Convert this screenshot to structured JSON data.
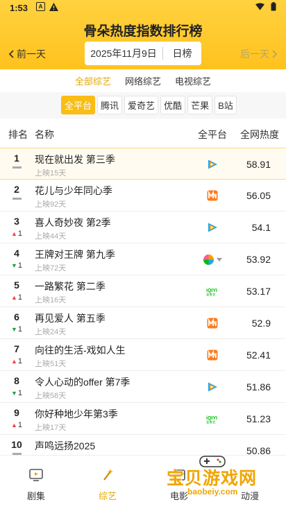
{
  "status": {
    "time": "1:53"
  },
  "header": {
    "title": "骨朵热度指数排行榜",
    "prev_label": "前一天",
    "next_label": "后一天",
    "date": "2025年11月9日",
    "period": "日榜"
  },
  "categories": [
    "全部综艺",
    "网络综艺",
    "电视综艺"
  ],
  "platforms": [
    "全平台",
    "腾讯",
    "爱奇艺",
    "优酷",
    "芒果",
    "B站"
  ],
  "table": {
    "headers": {
      "rank": "排名",
      "name": "名称",
      "platform": "全平台",
      "heat": "全网热度"
    },
    "rows": [
      {
        "rank": "1",
        "change": "",
        "dir": "flat",
        "name": "现在就出发 第三季",
        "sub": "上映15天",
        "platform": "tencent",
        "heat": "58.91"
      },
      {
        "rank": "2",
        "change": "",
        "dir": "flat",
        "name": "花儿与少年同心季",
        "sub": "上映92天",
        "platform": "mango",
        "heat": "56.05"
      },
      {
        "rank": "3",
        "change": "1",
        "dir": "up",
        "name": "喜人奇妙夜 第2季",
        "sub": "上映44天",
        "platform": "tencent",
        "heat": "54.1"
      },
      {
        "rank": "4",
        "change": "1",
        "dir": "down",
        "name": "王牌对王牌 第九季",
        "sub": "上映72天",
        "platform": "multi",
        "heat": "53.92"
      },
      {
        "rank": "5",
        "change": "1",
        "dir": "up",
        "name": "一路繁花 第二季",
        "sub": "上映16天",
        "platform": "iqiyi",
        "heat": "53.17"
      },
      {
        "rank": "6",
        "change": "1",
        "dir": "down",
        "name": "再见爱人 第五季",
        "sub": "上映24天",
        "platform": "mango",
        "heat": "52.9"
      },
      {
        "rank": "7",
        "change": "1",
        "dir": "up",
        "name": "向往的生活-戏如人生",
        "sub": "上映51天",
        "platform": "mango",
        "heat": "52.41"
      },
      {
        "rank": "8",
        "change": "1",
        "dir": "down",
        "name": "令人心动的offer 第7季",
        "sub": "上映58天",
        "platform": "tencent",
        "heat": "51.86"
      },
      {
        "rank": "9",
        "change": "1",
        "dir": "up",
        "name": "你好种地少年第3季",
        "sub": "上映17天",
        "platform": "iqiyi",
        "heat": "51.23"
      },
      {
        "rank": "10",
        "change": "",
        "dir": "flat",
        "name": "声鸣远扬2025",
        "sub": "",
        "platform": "none",
        "heat": "50.86"
      }
    ]
  },
  "tabs": [
    {
      "label": "剧集",
      "icon": "tv-icon",
      "active": false
    },
    {
      "label": "综艺",
      "icon": "magic-wand-icon",
      "active": true
    },
    {
      "label": "电影",
      "icon": "film-icon",
      "active": false
    },
    {
      "label": "动漫",
      "icon": "anime-icon",
      "active": false
    }
  ],
  "watermark": {
    "main": "宝贝游戏网",
    "sub": "baobeiy.com"
  },
  "colors": {
    "accent": "#f9bd16",
    "header_bg": "#ffc21e",
    "up": "#e44444",
    "down": "#2a9d3a"
  }
}
